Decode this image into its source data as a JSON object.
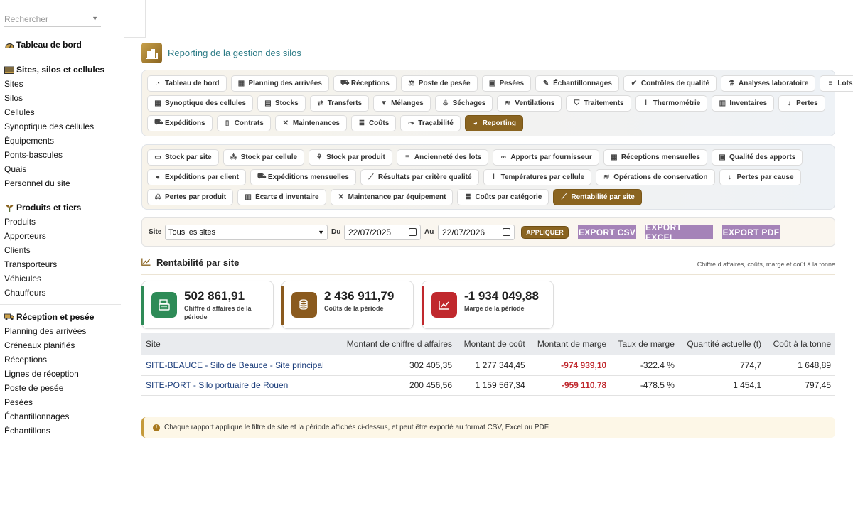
{
  "sidebar": {
    "search_placeholder": "Rechercher",
    "groups": [
      {
        "title": "Tableau de bord",
        "items": []
      },
      {
        "title": "Sites, silos et cellules",
        "items": [
          "Sites",
          "Silos",
          "Cellules",
          "Synoptique des cellules",
          "Équipements",
          "Ponts-bascules",
          "Quais",
          "Personnel du site"
        ]
      },
      {
        "title": "Produits et tiers",
        "items": [
          "Produits",
          "Apporteurs",
          "Clients",
          "Transporteurs",
          "Véhicules",
          "Chauffeurs"
        ]
      },
      {
        "title": "Réception et pesée",
        "items": [
          "Planning des arrivées",
          "Créneaux planifiés",
          "Réceptions",
          "Lignes de réception",
          "Poste de pesée",
          "Pesées",
          "Échantillonnages",
          "Échantillons"
        ]
      }
    ]
  },
  "page_title": "Reporting de la gestion des silos",
  "nav": {
    "rows": [
      [
        "Tableau de bord",
        "Planning des arrivées",
        "Réceptions",
        "Poste de pesée",
        "Pesées",
        "Échantillonnages",
        "Contrôles de qualité",
        "Analyses laboratoire",
        "Lots"
      ],
      [
        "Synoptique des cellules",
        "Stocks",
        "Transferts",
        "Mélanges",
        "Séchages",
        "Ventilations",
        "Traitements",
        "Thermométrie",
        "Inventaires",
        "Pertes"
      ],
      [
        "Expéditions",
        "Contrats",
        "Maintenances",
        "Coûts",
        "Traçabilité",
        "Reporting"
      ]
    ],
    "active": "Reporting"
  },
  "reports": {
    "rows": [
      [
        "Stock par site",
        "Stock par cellule",
        "Stock par produit",
        "Ancienneté des lots",
        "Apports par fournisseur",
        "Réceptions mensuelles",
        "Qualité des apports"
      ],
      [
        "Expéditions par client",
        "Expéditions mensuelles",
        "Résultats par critère qualité",
        "Températures par cellule",
        "Opérations de conservation",
        "Pertes par cause"
      ],
      [
        "Pertes par produit",
        "Écarts d inventaire",
        "Maintenance par équipement",
        "Coûts par catégorie",
        "Rentabilité par site"
      ]
    ],
    "active": "Rentabilité par site"
  },
  "filters": {
    "site_label": "Site",
    "site_value": "Tous les sites",
    "from_label": "Du",
    "from_value": "22/07/2025",
    "to_label": "Au",
    "to_value": "22/07/2026",
    "apply_label": "APPLIQUER",
    "export_csv": "EXPORT CSV",
    "export_excel": "EXPORT EXCEL",
    "export_pdf": "EXPORT PDF"
  },
  "section": {
    "title": "Rentabilité par site",
    "subtitle": "Chiffre d affaires, coûts, marge et coût à la tonne"
  },
  "cards": [
    {
      "value": "502 861,91",
      "label_line1": "Chiffre d affaires de la",
      "label_line2": "période",
      "color": "#2e8b57"
    },
    {
      "value": "2 436 911,79",
      "label_line1": "Coûts de la période",
      "label_line2": "",
      "color": "#8a5a1e"
    },
    {
      "value": "-1 934 049,88",
      "label_line1": "Marge de la période",
      "label_line2": "",
      "color": "#c0282d"
    }
  ],
  "table": {
    "headers": [
      "Site",
      "Montant de chiffre d affaires",
      "Montant de coût",
      "Montant de marge",
      "Taux de marge",
      "Quantité actuelle (t)",
      "Coût à la tonne"
    ],
    "rows": [
      [
        "SITE-BEAUCE - Silo de Beauce - Site principal",
        "302 405,35",
        "1 277 344,45",
        "-974 939,10",
        "-322.4 %",
        "774,7",
        "1 648,89"
      ],
      [
        "SITE-PORT - Silo portuaire de Rouen",
        "200 456,56",
        "1 159 567,34",
        "-959 110,78",
        "-478.5 %",
        "1 454,1",
        "797,45"
      ]
    ]
  },
  "note": "Chaque rapport applique le filtre de site et la période affichés ci-dessus, et peut être exporté au format CSV, Excel ou PDF."
}
